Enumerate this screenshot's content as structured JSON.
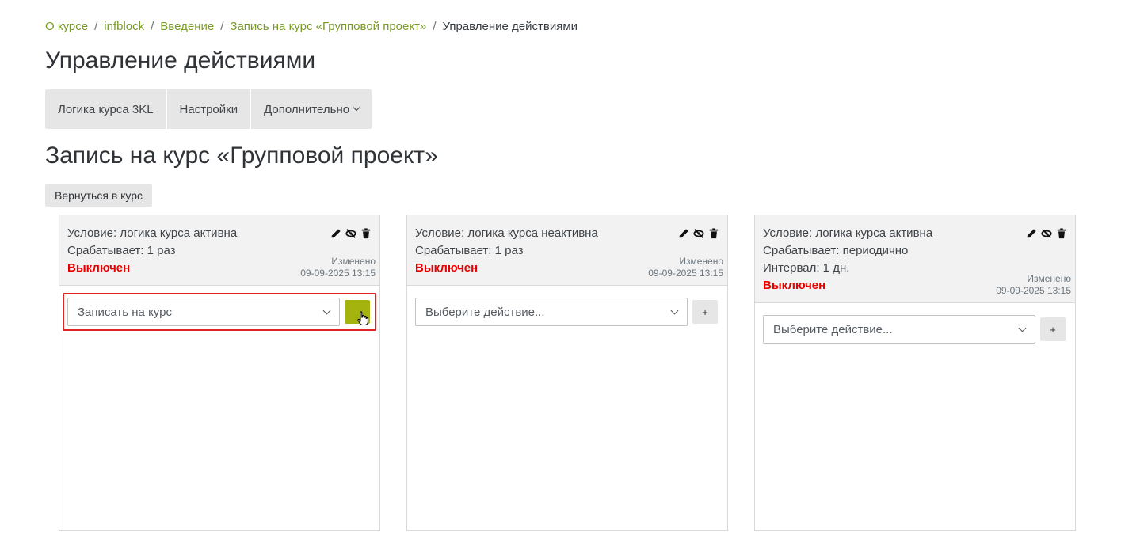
{
  "breadcrumb": {
    "items": [
      "О курсе",
      "infblock",
      "Введение",
      "Запись на курс «Групповой проект»"
    ],
    "current": "Управление действиями",
    "separator": "/"
  },
  "page_title": "Управление действиями",
  "tabs": [
    {
      "label": "Логика курса 3KL"
    },
    {
      "label": "Настройки"
    },
    {
      "label": "Дополнительно"
    }
  ],
  "section_title": "Запись на курс «Групповой проект»",
  "back_button": "Вернуться в курс",
  "cards": [
    {
      "condition": "Условие: логика курса активна",
      "trigger": "Срабатывает: 1 раз",
      "interval": "",
      "status": "Выключен",
      "modified_label": "Изменено",
      "modified_date": "09-09-2025 13:15",
      "select_value": "Записать на курс",
      "add_label": "+"
    },
    {
      "condition": "Условие: логика курса неактивна",
      "trigger": "Срабатывает: 1 раз",
      "interval": "",
      "status": "Выключен",
      "modified_label": "Изменено",
      "modified_date": "09-09-2025 13:15",
      "select_value": "Выберите действие...",
      "add_label": "+"
    },
    {
      "condition": "Условие: логика курса активна",
      "trigger": "Срабатывает: периодично",
      "interval": "Интервал: 1 дн.",
      "status": "Выключен",
      "modified_label": "Изменено",
      "modified_date": "09-09-2025 13:15",
      "select_value": "Выберите действие...",
      "add_label": "+"
    }
  ],
  "colors": {
    "link": "#7a9a2a",
    "status_off": "#e60000",
    "accent_button": "#a4b30d",
    "highlight_border": "#e02424"
  }
}
